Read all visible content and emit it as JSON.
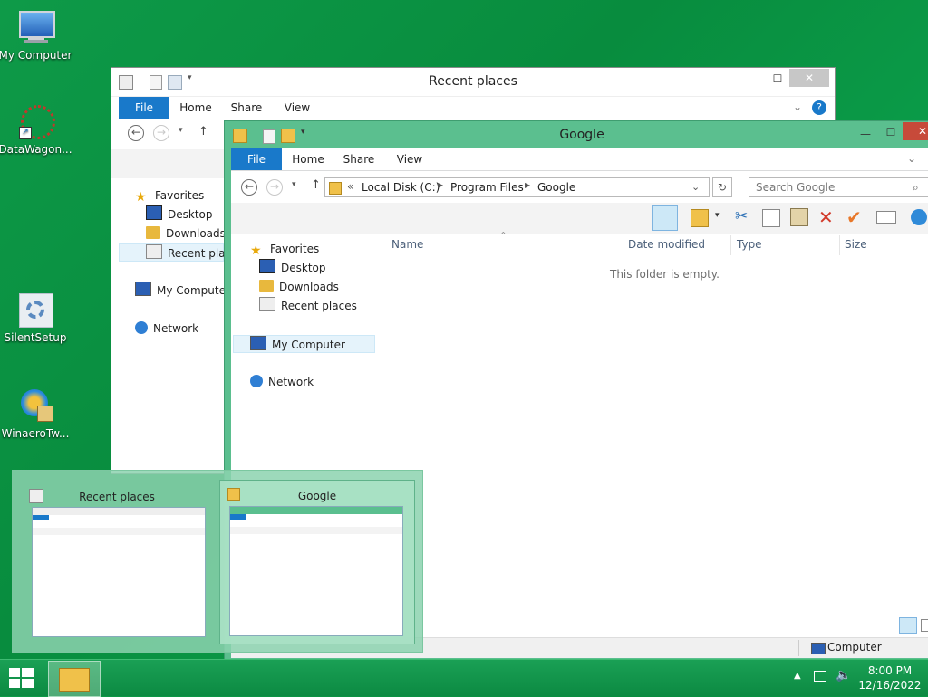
{
  "desktop": {
    "icons": [
      {
        "label": "My Computer"
      },
      {
        "label": "DataWagon..."
      },
      {
        "label": "SilentSetup"
      },
      {
        "label": "WinaeroTw..."
      }
    ]
  },
  "window_back": {
    "title": "Recent places",
    "tabs": [
      "File",
      "Home",
      "Share",
      "View"
    ],
    "nav": {
      "favorites": "Favorites",
      "desktop": "Desktop",
      "downloads": "Downloads",
      "recent": "Recent place",
      "computer": "My Computer",
      "network": "Network"
    }
  },
  "window_front": {
    "title": "Google",
    "tabs": [
      "File",
      "Home",
      "Share",
      "View"
    ],
    "address": {
      "prefix": "«",
      "segments": [
        "Local Disk (C:)",
        "Program Files",
        "Google"
      ]
    },
    "search_placeholder": "Search Google",
    "nav": {
      "favorites": "Favorites",
      "desktop": "Desktop",
      "downloads": "Downloads",
      "recent": "Recent places",
      "computer": "My Computer",
      "network": "Network"
    },
    "columns": [
      "Name",
      "Date modified",
      "Type",
      "Size"
    ],
    "empty_message": "This folder is empty.",
    "status_right": "Computer"
  },
  "taskbar_preview": {
    "items": [
      {
        "title": "Recent places"
      },
      {
        "title": "Google"
      }
    ]
  },
  "tray": {
    "time": "8:00 PM",
    "date": "12/16/2022"
  },
  "colors": {
    "accent": "#1979ca",
    "window_frame": "#5bbf8f",
    "desktop": "#0b9645"
  }
}
